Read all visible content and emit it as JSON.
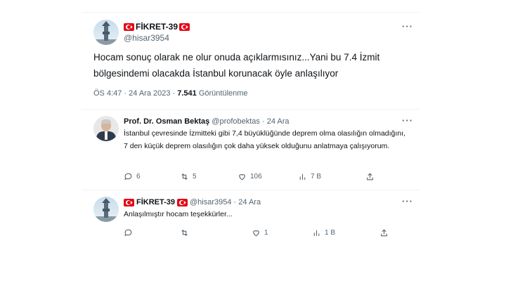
{
  "main_tweet": {
    "display_name": "FİKRET-39",
    "handle": "@hisar3954",
    "more": "···",
    "text": "Hocam sonuç olarak ne olur onuda açıklarmısınız...Yani bu 7.4 İzmit bölgesindemi olacakda İstanbul korunacak öyle anlaşılıyor",
    "time": "ÖS 4:47 · 24 Ara 2023 · ",
    "views_count": "7.541",
    "views_label": " Görüntülenme"
  },
  "replies": [
    {
      "display_name": "Prof. Dr. Osman Bektaş",
      "handle_date": "@profobektas · 24 Ara",
      "more": "···",
      "text": "İstanbul çevresinde İzmitteki gibi 7,4 büyüklüğünde deprem olma olasılığın olmadığını, 7 den küçük deprem olasılığın çok daha yüksek olduğunu anlatmaya çalışıyorum.",
      "replies": "6",
      "retweets": "5",
      "likes": "106",
      "views": "7 B"
    },
    {
      "display_name": "FİKRET-39",
      "handle_date": "@hisar3954 · 24 Ara",
      "more": "···",
      "text": "Anlaşılmıştır hocam teşekkürler...",
      "replies": "",
      "retweets": "",
      "likes": "1",
      "views": "1 B"
    }
  ],
  "colors": {
    "text": "#0f1419",
    "muted": "#536471",
    "divider": "#eff3f4",
    "flag": "#e30a17"
  }
}
